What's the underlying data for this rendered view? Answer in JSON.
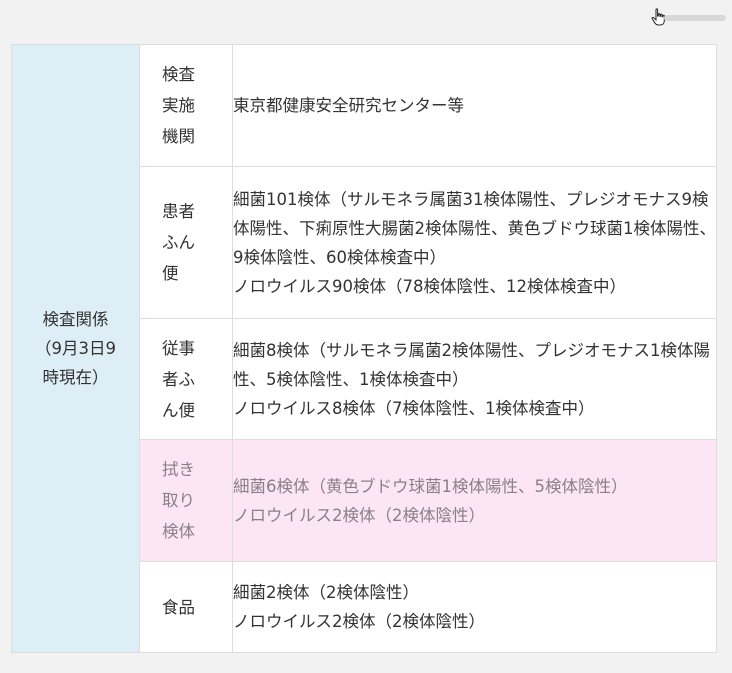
{
  "group_label": "検査関係（9月3日9時現在）",
  "rows": [
    {
      "label": "検査実施機関",
      "lines": [
        "東京都健康安全研究センター等"
      ],
      "highlight": false
    },
    {
      "label": "患者ふん便",
      "lines": [
        "細菌101検体（サルモネラ属菌31検体陽性、プレジオモナス9検体陽性、下痢原性大腸菌2検体陽性、黄色ブドウ球菌1検体陽性、9検体陰性、60検体検査中）",
        "ノロウイルス90検体（78検体陰性、12検体検査中）"
      ],
      "highlight": false
    },
    {
      "label": "従事者ふん便",
      "lines": [
        "細菌8検体（サルモネラ属菌2検体陽性、プレジオモナス1検体陽性、5検体陰性、1検体検査中）",
        "ノロウイルス8検体（7検体陰性、1検体検査中）"
      ],
      "highlight": false
    },
    {
      "label": "拭き取り検体",
      "lines": [
        "細菌6検体（黄色ブドウ球菌1検体陽性、5検体陰性）",
        "ノロウイルス2検体（2検体陰性）"
      ],
      "highlight": true
    },
    {
      "label": "食品",
      "lines": [
        "細菌2検体（2検体陰性）",
        "ノロウイルス2検体（2検体陰性）"
      ],
      "highlight": false
    }
  ],
  "icons": {
    "cursor": "hand-pointer-icon"
  },
  "colors": {
    "group_bg": "#ddeef6",
    "highlight_bg": "#fce6f6",
    "border": "#dddddd"
  }
}
